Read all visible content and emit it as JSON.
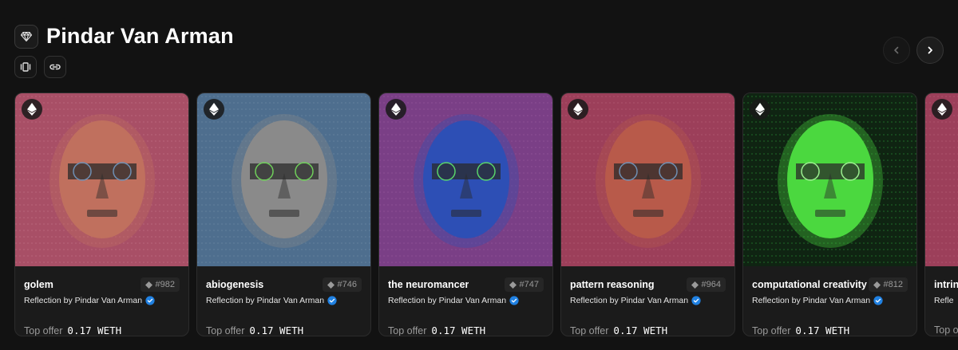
{
  "header": {
    "title": "Pindar Van Arman"
  },
  "cards": [
    {
      "name": "golem",
      "token": "#982",
      "collection": "Reflection by Pindar Van Arman",
      "offer_label": "Top offer",
      "offer_value": "0.17 WETH",
      "art": {
        "bg": "#a84f66",
        "pattern": "#b96479",
        "face": "#c0705e",
        "accent": "#6e8fb3"
      }
    },
    {
      "name": "abiogenesis",
      "token": "#746",
      "collection": "Reflection by Pindar Van Arman",
      "offer_label": "Top offer",
      "offer_value": "0.17 WETH",
      "art": {
        "bg": "#4e6e8e",
        "pattern": "#61809c",
        "face": "#8a8a8a",
        "accent": "#6fcf5a"
      }
    },
    {
      "name": "the neuromancer",
      "token": "#747",
      "collection": "Reflection by Pindar Van Arman",
      "offer_label": "Top offer",
      "offer_value": "0.17 WETH",
      "art": {
        "bg": "#7a3f86",
        "pattern": "#8c4f94",
        "face": "#2d4fb5",
        "accent": "#59d46a"
      }
    },
    {
      "name": "pattern reasoning",
      "token": "#964",
      "collection": "Reflection by Pindar Van Arman",
      "offer_label": "Top offer",
      "offer_value": "0.17 WETH",
      "art": {
        "bg": "#9c3f5a",
        "pattern": "#ad536c",
        "face": "#b85a4a",
        "accent": "#6e8fb3"
      }
    },
    {
      "name": "computational creativity",
      "token": "#812",
      "collection": "Reflection by Pindar Van Arman",
      "offer_label": "Top offer",
      "offer_value": "0.17 WETH",
      "art": {
        "bg": "#0f2412",
        "pattern": "#1f6a28",
        "face": "#4bd83f",
        "accent": "#9bf08f"
      }
    },
    {
      "name": "intrins",
      "token": "",
      "collection": "Refle",
      "offer_label": "Top o",
      "offer_value": "",
      "art": {
        "bg": "#9c3f5a",
        "pattern": "#ad536c",
        "face": "#b85a4a",
        "accent": "#6e8fb3"
      }
    }
  ]
}
